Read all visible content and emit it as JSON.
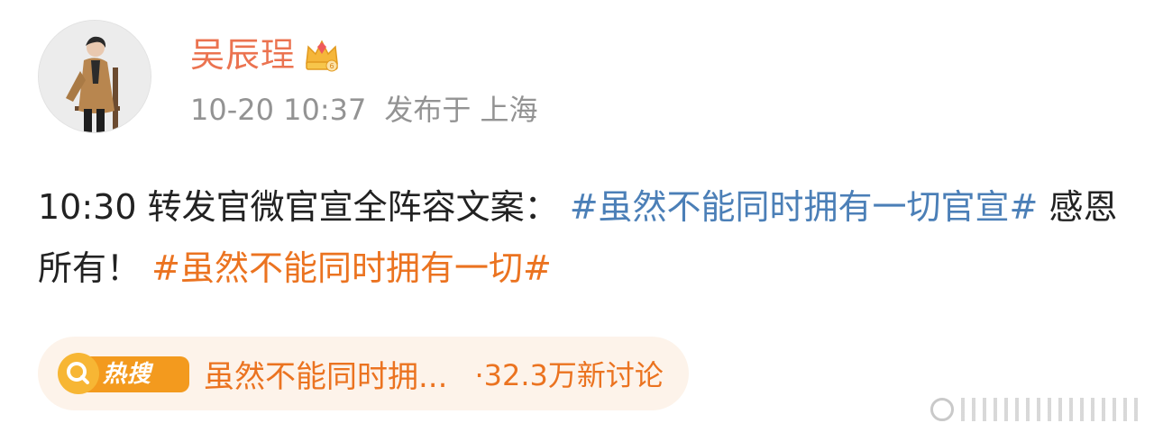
{
  "post": {
    "username": "吴辰珵",
    "badge_icon": "crown-icon",
    "timestamp": "10-20 10:37",
    "location": "发布于 上海",
    "content": {
      "lead": "10:30 转发官微官宣全阵容文案：",
      "hashtag_blue": "#虽然不能同时拥有一切官宣#",
      "middle": "感恩所有！",
      "hashtag_orange": "#虽然不能同时拥有一切#"
    }
  },
  "hot_search": {
    "badge_label": "热搜",
    "topic": "虽然不能同时拥...",
    "count": "·32.3万新讨论"
  },
  "colors": {
    "username": "#eb7350",
    "hashtag_blue": "#4b7fb7",
    "hashtag_orange": "#eb7320",
    "meta": "#939393",
    "hot_background": "#fdf3ea",
    "hot_badge": "#f39a1e"
  }
}
